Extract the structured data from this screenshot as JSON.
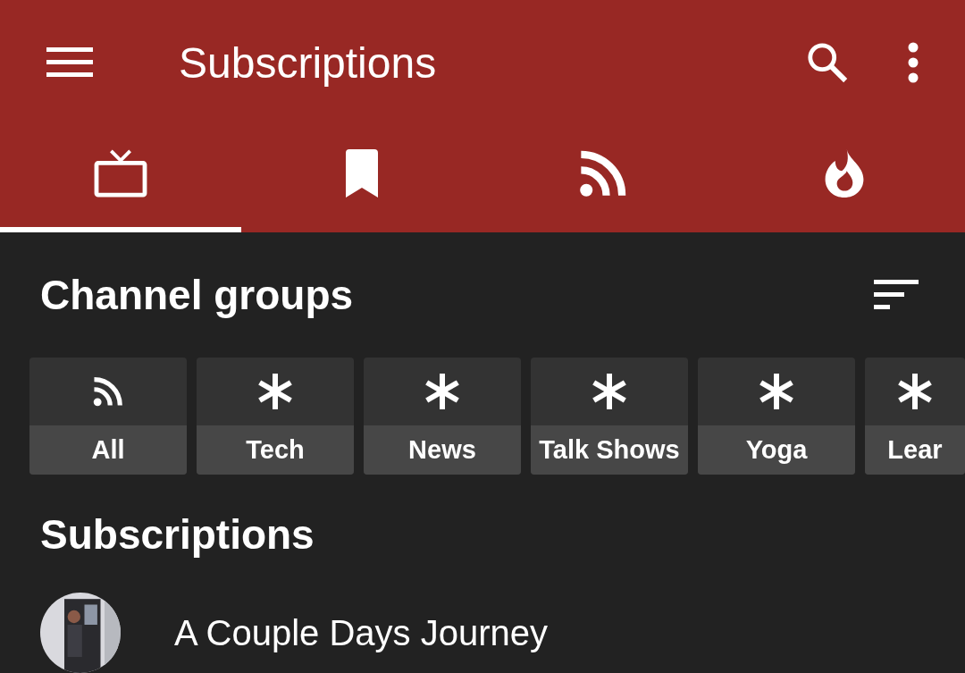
{
  "app_bar": {
    "title": "Subscriptions"
  },
  "tabs": [
    {
      "kind": "tv",
      "selected": true
    },
    {
      "kind": "bookmark",
      "selected": false
    },
    {
      "kind": "feed",
      "selected": false
    },
    {
      "kind": "trending",
      "selected": false
    }
  ],
  "channel_groups": {
    "heading": "Channel groups",
    "items": [
      {
        "kind": "feed",
        "label": "All"
      },
      {
        "kind": "group",
        "label": "Tech"
      },
      {
        "kind": "group",
        "label": "News"
      },
      {
        "kind": "group",
        "label": "Talk Shows"
      },
      {
        "kind": "group",
        "label": "Yoga"
      },
      {
        "kind": "group",
        "label": "Lear"
      }
    ]
  },
  "subscriptions": {
    "heading": "Subscriptions",
    "items": [
      {
        "name": "A Couple Days Journey"
      }
    ]
  }
}
